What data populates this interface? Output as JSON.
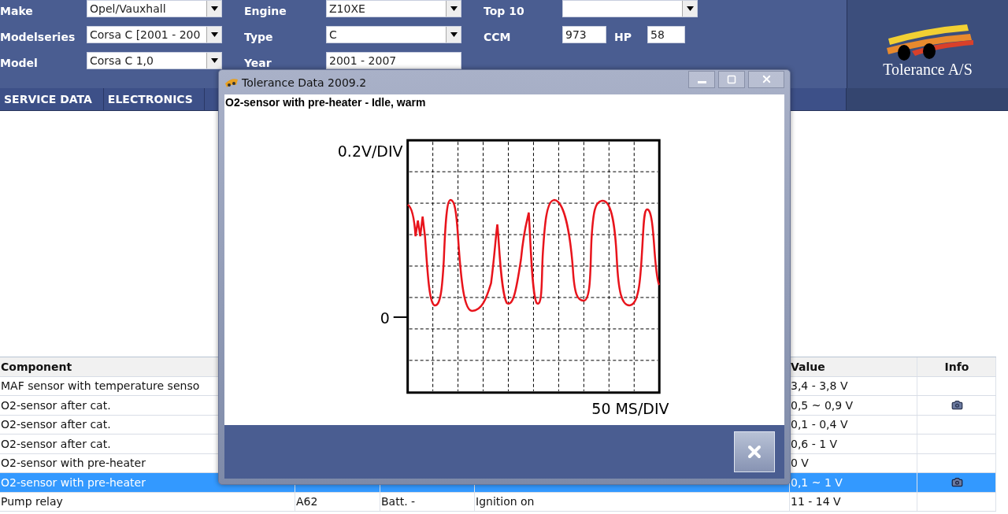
{
  "vehicle_form": {
    "fields": [
      {
        "label": "Make",
        "kind": "select",
        "value": "Opel/Vauxhall"
      },
      {
        "label": "Modelseries",
        "kind": "select",
        "value": "Corsa C [2001 - 200"
      },
      {
        "label": "Model",
        "kind": "select",
        "value": "Corsa C 1,0"
      },
      {
        "label": "Engine",
        "kind": "select",
        "value": "Z10XE"
      },
      {
        "label": "Type",
        "kind": "select",
        "value": "C"
      },
      {
        "label": "Year",
        "kind": "text",
        "value": "2001 - 2007"
      },
      {
        "label": "Top 10",
        "kind": "select"
      }
    ],
    "ccm": {
      "label": "CCM",
      "value": "973"
    },
    "hp": {
      "label": "HP",
      "value": "58"
    }
  },
  "logo": {
    "text": "Tolerance A/S"
  },
  "tabs": [
    "SERVICE DATA",
    "ELECTRONICS"
  ],
  "table": {
    "columns": [
      "Component",
      "Value",
      "Info"
    ],
    "rows": [
      {
        "component": "MAF sensor with temperature senso",
        "value": "3,4 - 3,8 V",
        "photo": false,
        "selected": false
      },
      {
        "component": "O2-sensor after cat.",
        "value": "0,5 ~ 0,9 V",
        "photo": true,
        "selected": false
      },
      {
        "component": "O2-sensor after cat.",
        "value": "0,1 - 0,4 V",
        "photo": false,
        "selected": false
      },
      {
        "component": "O2-sensor after cat.",
        "value": "0,6 - 1 V",
        "photo": false,
        "selected": false
      },
      {
        "component": "O2-sensor with pre-heater",
        "value": "0 V",
        "photo": false,
        "selected": false
      },
      {
        "component": "O2-sensor with pre-heater",
        "value": "0,1 ~ 1 V",
        "photo": true,
        "selected": true
      },
      {
        "component": "Pump relay",
        "column_2": "A62",
        "column_3": "Batt. -",
        "column_4": "Ignition on",
        "value": "11 - 14 V",
        "photo": false,
        "selected": false
      }
    ]
  },
  "dialog": {
    "title": "Tolerance Data 2009.2",
    "heading": "O2-sensor with pre-heater - Idle, warm",
    "scope": {
      "y_scale": "0.2V/DIV",
      "zero_label": "0",
      "x_scale": "50 MS/DIV"
    }
  }
}
